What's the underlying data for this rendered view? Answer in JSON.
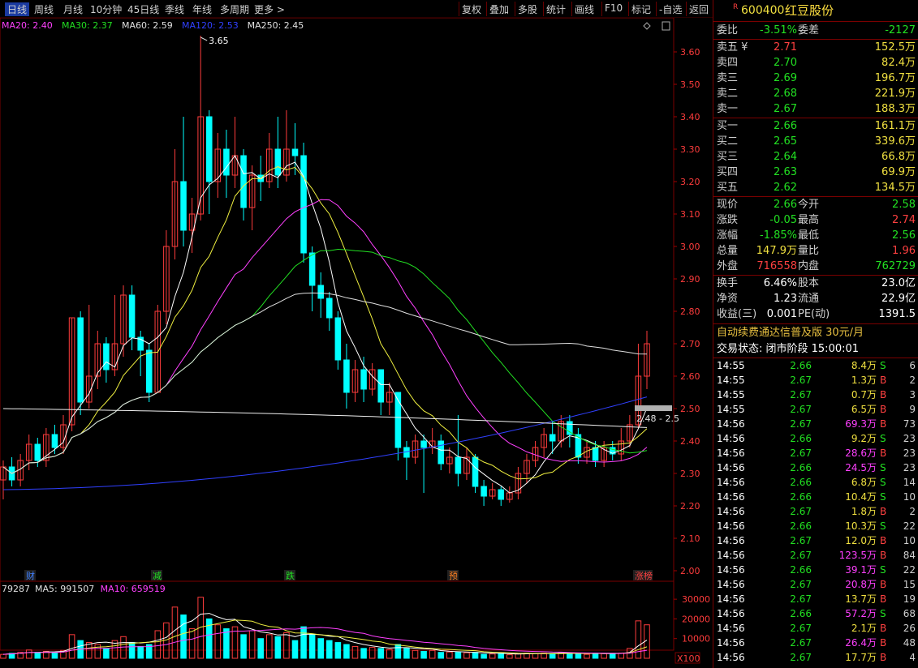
{
  "toolbar": {
    "left": [
      "日线",
      "周线",
      "月线",
      "10分钟",
      "45日线",
      "季线",
      "年线",
      "多周期",
      "更多 >"
    ],
    "active_index": 0,
    "right": [
      "复权",
      "叠加",
      "多股",
      "统计",
      "画线",
      "F10",
      "标记",
      "-自选",
      "返回"
    ]
  },
  "ma_legend": [
    {
      "text": "MA20: 2.40",
      "color": "#ff40ff"
    },
    {
      "text": "MA30: 2.37",
      "color": "#22e022"
    },
    {
      "text": "MA60: 2.59",
      "color": "#e0e0e0"
    },
    {
      "text": "MA120: 2.53",
      "color": "#3040ff"
    },
    {
      "text": "MA250: 2.45",
      "color": "#e0e0e0"
    }
  ],
  "vol_legend": [
    {
      "text": "79287",
      "color": "#e0e0e0"
    },
    {
      "text": "MA5: 991507",
      "color": "#e0e0e0"
    },
    {
      "text": "MA10: 659519",
      "color": "#ff40ff"
    }
  ],
  "price_axis": [
    "3.60",
    "3.50",
    "3.40",
    "3.30",
    "3.20",
    "3.10",
    "3.00",
    "2.90",
    "2.80",
    "2.70",
    "2.60",
    "2.50",
    "2.40",
    "2.30",
    "2.20",
    "2.10",
    "2.00"
  ],
  "vol_axis": [
    "30000",
    "20000",
    "10000"
  ],
  "vol_unit": "X100",
  "high_label": "3.65",
  "current_label": "2.48 - 2.5",
  "event_markers": [
    {
      "text": "财",
      "color": "#4080ff"
    },
    {
      "text": "减",
      "color": "#22e022"
    },
    {
      "text": "跌",
      "color": "#22e022"
    },
    {
      "text": "预",
      "color": "#ff8020"
    },
    {
      "text": "涨榜",
      "color": "#ff4040"
    }
  ],
  "chart_data": {
    "type": "candlestick",
    "title": "600400 红豆股份",
    "ylim": [
      2.0,
      3.65
    ],
    "candles": [
      [
        2.28,
        2.32,
        2.22,
        2.34
      ],
      [
        2.32,
        2.28,
        2.26,
        2.35
      ],
      [
        2.28,
        2.34,
        2.26,
        2.36
      ],
      [
        2.34,
        2.39,
        2.31,
        2.42
      ],
      [
        2.39,
        2.34,
        2.32,
        2.41
      ],
      [
        2.34,
        2.42,
        2.32,
        2.44
      ],
      [
        2.42,
        2.38,
        2.36,
        2.45
      ],
      [
        2.38,
        2.45,
        2.36,
        2.48
      ],
      [
        2.45,
        2.78,
        2.43,
        2.78
      ],
      [
        2.78,
        2.52,
        2.48,
        2.8
      ],
      [
        2.52,
        2.6,
        2.5,
        2.82
      ],
      [
        2.6,
        2.7,
        2.56,
        2.74
      ],
      [
        2.7,
        2.62,
        2.58,
        2.72
      ],
      [
        2.62,
        2.7,
        2.6,
        2.85
      ],
      [
        2.7,
        2.85,
        2.66,
        2.88
      ],
      [
        2.85,
        2.72,
        2.68,
        2.88
      ],
      [
        2.72,
        2.68,
        2.6,
        2.74
      ],
      [
        2.68,
        2.55,
        2.52,
        2.7
      ],
      [
        2.55,
        2.8,
        2.55,
        2.82
      ],
      [
        2.8,
        3.0,
        2.76,
        3.05
      ],
      [
        3.0,
        3.2,
        2.96,
        3.3
      ],
      [
        3.2,
        3.05,
        3.0,
        3.4
      ],
      [
        3.05,
        3.1,
        2.98,
        3.15
      ],
      [
        3.1,
        3.4,
        3.08,
        3.65
      ],
      [
        3.4,
        3.2,
        3.1,
        3.42
      ],
      [
        3.2,
        3.3,
        3.15,
        3.35
      ],
      [
        3.3,
        3.22,
        3.15,
        3.36
      ],
      [
        3.22,
        3.28,
        3.18,
        3.4
      ],
      [
        3.28,
        3.12,
        3.08,
        3.3
      ],
      [
        3.12,
        3.22,
        3.05,
        3.25
      ],
      [
        3.22,
        3.2,
        3.14,
        3.28
      ],
      [
        3.2,
        3.3,
        3.18,
        3.35
      ],
      [
        3.3,
        3.22,
        3.18,
        3.4
      ],
      [
        3.22,
        3.3,
        3.2,
        3.42
      ],
      [
        3.3,
        3.28,
        3.22,
        3.38
      ],
      [
        3.28,
        2.98,
        2.95,
        3.32
      ],
      [
        2.98,
        2.88,
        2.8,
        3.0
      ],
      [
        2.88,
        2.84,
        2.78,
        2.92
      ],
      [
        2.84,
        2.78,
        2.74,
        2.86
      ],
      [
        2.78,
        2.65,
        2.62,
        2.8
      ],
      [
        2.65,
        2.55,
        2.5,
        2.7
      ],
      [
        2.55,
        2.62,
        2.52,
        2.65
      ],
      [
        2.62,
        2.56,
        2.52,
        2.66
      ],
      [
        2.56,
        2.62,
        2.54,
        2.64
      ],
      [
        2.62,
        2.52,
        2.48,
        2.62
      ],
      [
        2.52,
        2.55,
        2.48,
        2.58
      ],
      [
        2.55,
        2.38,
        2.34,
        2.55
      ],
      [
        2.38,
        2.35,
        2.28,
        2.4
      ],
      [
        2.35,
        2.4,
        2.33,
        2.42
      ],
      [
        2.4,
        2.38,
        2.24,
        2.42
      ],
      [
        2.38,
        2.4,
        2.36,
        2.44
      ],
      [
        2.4,
        2.33,
        2.31,
        2.42
      ],
      [
        2.33,
        2.35,
        2.3,
        2.38
      ],
      [
        2.35,
        2.3,
        2.26,
        2.48
      ],
      [
        2.3,
        2.35,
        2.28,
        2.38
      ],
      [
        2.35,
        2.26,
        2.24,
        2.36
      ],
      [
        2.26,
        2.23,
        2.2,
        2.28
      ],
      [
        2.23,
        2.25,
        2.22,
        2.27
      ],
      [
        2.25,
        2.22,
        2.2,
        2.26
      ],
      [
        2.22,
        2.24,
        2.21,
        2.26
      ],
      [
        2.24,
        2.3,
        2.22,
        2.32
      ],
      [
        2.3,
        2.34,
        2.27,
        2.36
      ],
      [
        2.34,
        2.38,
        2.32,
        2.4
      ],
      [
        2.38,
        2.42,
        2.35,
        2.44
      ],
      [
        2.42,
        2.4,
        2.36,
        2.46
      ],
      [
        2.4,
        2.46,
        2.38,
        2.48
      ],
      [
        2.46,
        2.42,
        2.38,
        2.48
      ],
      [
        2.42,
        2.35,
        2.33,
        2.44
      ],
      [
        2.35,
        2.38,
        2.33,
        2.4
      ],
      [
        2.38,
        2.34,
        2.32,
        2.4
      ],
      [
        2.34,
        2.38,
        2.32,
        2.4
      ],
      [
        2.38,
        2.36,
        2.34,
        2.4
      ],
      [
        2.36,
        2.4,
        2.34,
        2.44
      ],
      [
        2.4,
        2.45,
        2.38,
        2.48
      ],
      [
        2.45,
        2.6,
        2.44,
        2.7
      ],
      [
        2.6,
        2.7,
        2.56,
        2.74
      ]
    ],
    "volume": [
      2000,
      2500,
      3000,
      4200,
      3000,
      3500,
      2800,
      4000,
      12000,
      9000,
      8000,
      7000,
      5000,
      9000,
      11000,
      8000,
      6000,
      7000,
      14000,
      18000,
      26000,
      22000,
      15000,
      31000,
      20000,
      17000,
      15000,
      16000,
      12000,
      14000,
      10000,
      12000,
      11000,
      13000,
      9000,
      16000,
      12000,
      10000,
      9000,
      8000,
      7000,
      6000,
      5000,
      5500,
      5000,
      4500,
      7000,
      5000,
      4000,
      3500,
      4000,
      3000,
      3200,
      3000,
      2800,
      3000,
      2000,
      2200,
      2500,
      1800,
      2200,
      2600,
      2400,
      2600,
      2500,
      3000,
      2800,
      2200,
      2000,
      2600,
      2400,
      2500,
      2600,
      5000,
      19000,
      17000
    ]
  },
  "panel": {
    "code": "600400",
    "name": "红豆股份",
    "r_mark": "R",
    "weibi": {
      "label": "委比",
      "value": "-3.51%",
      "label2": "委差",
      "value2": "-2127"
    },
    "sells": [
      {
        "label": "卖五 ¥",
        "price": "2.71",
        "vol": "152.5万"
      },
      {
        "label": "卖四",
        "price": "2.70",
        "vol": "82.4万"
      },
      {
        "label": "卖三",
        "price": "2.69",
        "vol": "196.7万"
      },
      {
        "label": "卖二",
        "price": "2.68",
        "vol": "221.9万"
      },
      {
        "label": "卖一",
        "price": "2.67",
        "vol": "188.3万"
      }
    ],
    "buys": [
      {
        "label": "买一",
        "price": "2.66",
        "vol": "161.1万"
      },
      {
        "label": "买二",
        "price": "2.65",
        "vol": "339.6万"
      },
      {
        "label": "买三",
        "price": "2.64",
        "vol": "66.8万"
      },
      {
        "label": "买四",
        "price": "2.63",
        "vol": "69.9万"
      },
      {
        "label": "买五",
        "price": "2.62",
        "vol": "134.5万"
      }
    ],
    "quote": [
      {
        "l1": "现价",
        "v1": "2.66",
        "c1": "green",
        "l2": "今开",
        "v2": "2.58",
        "c2": "green"
      },
      {
        "l1": "涨跌",
        "v1": "-0.05",
        "c1": "green",
        "l2": "最高",
        "v2": "2.74",
        "c2": "red"
      },
      {
        "l1": "涨幅",
        "v1": "-1.85%",
        "c1": "green",
        "l2": "最低",
        "v2": "2.56",
        "c2": "green"
      },
      {
        "l1": "总量",
        "v1": "147.9万",
        "c1": "yellow",
        "l2": "量比",
        "v2": "1.96",
        "c2": "red"
      },
      {
        "l1": "外盘",
        "v1": "716558",
        "c1": "red",
        "l2": "内盘",
        "v2": "762729",
        "c2": "green"
      }
    ],
    "info": [
      {
        "l1": "换手",
        "v1": "6.46%",
        "l2": "股本",
        "v2": "23.0亿"
      },
      {
        "l1": "净资",
        "v1": "1.23",
        "l2": "流通",
        "v2": "22.9亿"
      },
      {
        "l1": "收益(三)",
        "v1": "0.001",
        "l2": "PE(动)",
        "v2": "1391.5"
      }
    ],
    "promo": "自动续费通达信普及版  30元/月",
    "trade_state": "交易状态: 闭市阶段 15:00:01",
    "ticks": [
      {
        "t": "14:55",
        "p": "2.66",
        "v": "8.4万",
        "d": "S",
        "n": "6"
      },
      {
        "t": "14:55",
        "p": "2.67",
        "v": "1.3万",
        "d": "B",
        "n": "2"
      },
      {
        "t": "14:55",
        "p": "2.67",
        "v": "0.7万",
        "d": "B",
        "n": "3"
      },
      {
        "t": "14:55",
        "p": "2.67",
        "v": "6.5万",
        "d": "B",
        "n": "9"
      },
      {
        "t": "14:56",
        "p": "2.67",
        "v": "69.3万",
        "d": "B",
        "n": "73"
      },
      {
        "t": "14:56",
        "p": "2.66",
        "v": "9.2万",
        "d": "S",
        "n": "23"
      },
      {
        "t": "14:56",
        "p": "2.67",
        "v": "28.6万",
        "d": "B",
        "n": "23"
      },
      {
        "t": "14:56",
        "p": "2.66",
        "v": "24.5万",
        "d": "S",
        "n": "23"
      },
      {
        "t": "14:56",
        "p": "2.66",
        "v": "6.8万",
        "d": "S",
        "n": "14"
      },
      {
        "t": "14:56",
        "p": "2.66",
        "v": "10.4万",
        "d": "S",
        "n": "10"
      },
      {
        "t": "14:56",
        "p": "2.67",
        "v": "1.8万",
        "d": "B",
        "n": "2"
      },
      {
        "t": "14:56",
        "p": "2.66",
        "v": "10.3万",
        "d": "S",
        "n": "22"
      },
      {
        "t": "14:56",
        "p": "2.67",
        "v": "12.0万",
        "d": "B",
        "n": "10"
      },
      {
        "t": "14:56",
        "p": "2.67",
        "v": "123.5万",
        "d": "B",
        "n": "84"
      },
      {
        "t": "14:56",
        "p": "2.66",
        "v": "39.1万",
        "d": "S",
        "n": "22"
      },
      {
        "t": "14:56",
        "p": "2.67",
        "v": "20.8万",
        "d": "B",
        "n": "15"
      },
      {
        "t": "14:56",
        "p": "2.67",
        "v": "13.7万",
        "d": "B",
        "n": "19"
      },
      {
        "t": "14:56",
        "p": "2.66",
        "v": "57.2万",
        "d": "S",
        "n": "68"
      },
      {
        "t": "14:56",
        "p": "2.67",
        "v": "2.1万",
        "d": "B",
        "n": "26"
      },
      {
        "t": "14:56",
        "p": "2.67",
        "v": "26.4万",
        "d": "B",
        "n": "48"
      },
      {
        "t": "14:56",
        "p": "2.67",
        "v": "17.7万",
        "d": "B",
        "n": "4"
      }
    ]
  }
}
